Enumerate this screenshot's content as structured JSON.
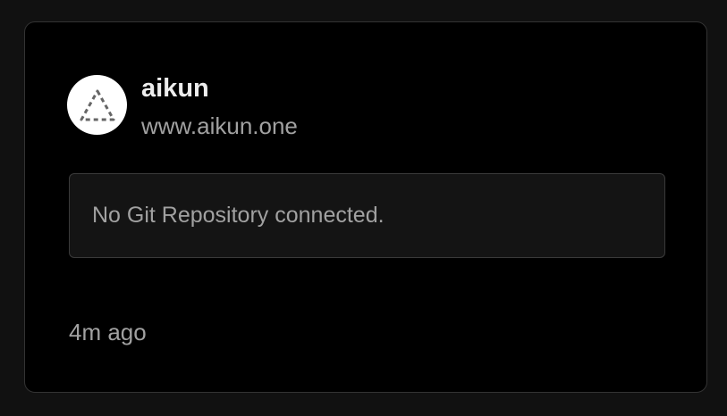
{
  "project": {
    "name": "aikun",
    "domain": "www.aikun.one",
    "avatar_icon": "triangle-dashed-icon"
  },
  "git": {
    "status_text": "No Git Repository connected."
  },
  "meta": {
    "updated": "4m ago"
  },
  "colors": {
    "page_bg": "#111111",
    "card_bg": "#000000",
    "card_border": "#333333",
    "primary_text": "#ededed",
    "secondary_text": "#a1a1a1"
  }
}
